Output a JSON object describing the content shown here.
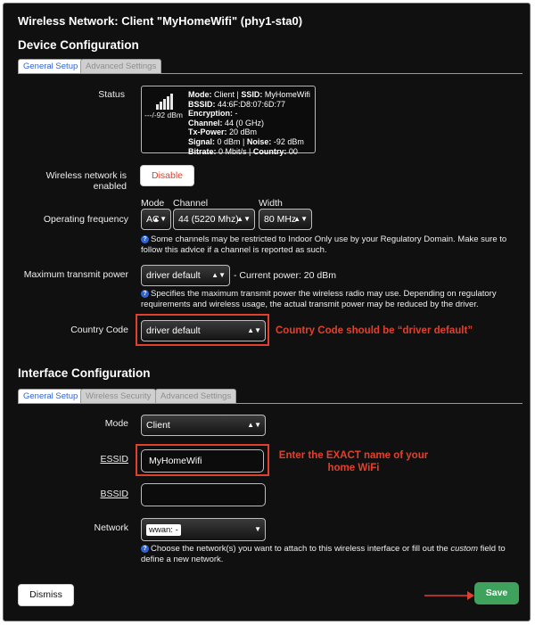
{
  "window_title": "Wireless Network: Client \"MyHomeWifi\" (phy1-sta0)",
  "device_config": {
    "heading": "Device Configuration",
    "tabs": [
      {
        "label": "General Setup",
        "active": true
      },
      {
        "label": "Advanced Settings",
        "active": false
      }
    ],
    "status": {
      "label": "Status",
      "signal_text": "---/-92 dBm",
      "lines": [
        {
          "key": "Mode:",
          "value": " Client | "
        },
        {
          "key": "SSID:",
          "value": " MyHomeWifi"
        }
      ],
      "bssid": {
        "key": "BSSID:",
        "value": " 44:6F:D8:07:6D:77"
      },
      "encryption": {
        "key": "Encryption:",
        "value": " -"
      },
      "channel": {
        "key": "Channel:",
        "value": " 44 (0 GHz)"
      },
      "txpower": {
        "key": "Tx-Power:",
        "value": " 20 dBm"
      },
      "signal": {
        "key": "Signal:",
        "value": " 0 dBm | ",
        "key2": "Noise:",
        "value2": " -92 dBm"
      },
      "bitrate": {
        "key": "Bitrate:",
        "value": " 0 Mbit/s | ",
        "key2": "Country:",
        "value2": " 00"
      }
    },
    "enabled": {
      "label": "Wireless network is enabled",
      "button": "Disable"
    },
    "frequency": {
      "label": "Operating frequency",
      "mode_header": "Mode",
      "channel_header": "Channel",
      "width_header": "Width",
      "mode_value": "AC",
      "channel_value": "44 (5220 Mhz)",
      "width_value": "80 MHz",
      "hint": "Some channels may be restricted to Indoor Only use by your Regulatory Domain. Make sure to follow this advice if a channel is reported as such."
    },
    "txpower": {
      "label": "Maximum transmit power",
      "value": "driver default",
      "current": "- Current power: 20 dBm",
      "hint": "Specifies the maximum transmit power the wireless radio may use. Depending on regulatory requirements and wireless usage, the actual transmit power may be reduced by the driver."
    },
    "country": {
      "label": "Country Code",
      "value": "driver default",
      "annotation": "Country Code should be “driver default”"
    }
  },
  "interface_config": {
    "heading": "Interface Configuration",
    "tabs": [
      {
        "label": "General Setup",
        "active": true
      },
      {
        "label": "Wireless Security",
        "active": false
      },
      {
        "label": "Advanced Settings",
        "active": false
      }
    ],
    "mode": {
      "label": "Mode",
      "value": "Client"
    },
    "essid": {
      "label": "ESSID",
      "value": "MyHomeWifi",
      "annotation_line1": "Enter the EXACT name of your",
      "annotation_line2": "home WiFi"
    },
    "bssid": {
      "label": "BSSID",
      "value": ""
    },
    "network": {
      "label": "Network",
      "value": "wwan: -",
      "hint_before": "Choose the network(s) you want to attach to this wireless interface or fill out the ",
      "hint_em": "custom",
      "hint_after": " field to define a new network."
    }
  },
  "footer": {
    "dismiss": "Dismiss",
    "save": "Save"
  },
  "colors": {
    "accent_blue": "#2f63d8",
    "annotation_red": "#e0412d",
    "save_green": "#3fa25c",
    "disable_red": "#d9412c"
  },
  "icons": {
    "hint": "help-circle-icon",
    "signal": "signal-bars-icon",
    "select_arrow": "updown-chevron-icon",
    "annotation_arrow": "right-arrow-icon"
  }
}
